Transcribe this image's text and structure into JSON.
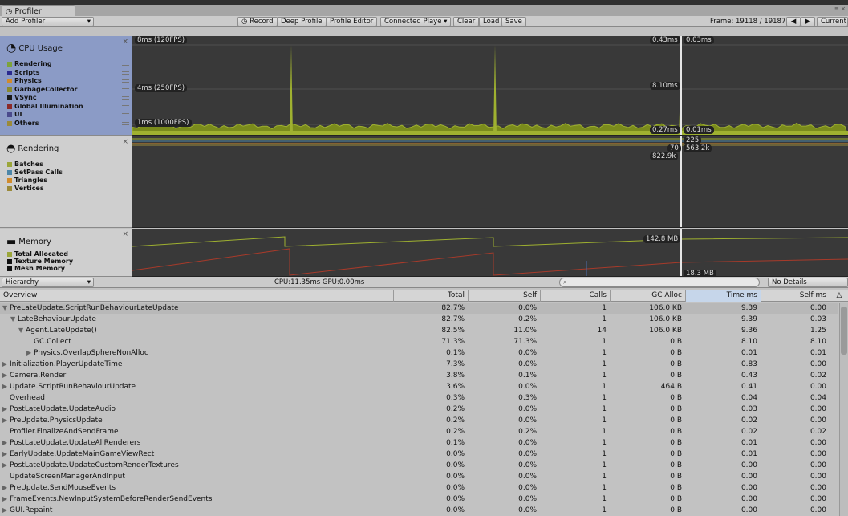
{
  "window": {
    "tab_title": "Profiler",
    "controls": "≡ ×"
  },
  "toolbar": {
    "add_profiler": "Add Profiler",
    "record": "Record",
    "deep_profile": "Deep Profile",
    "profile_editor": "Profile Editor",
    "connected_player": "Connected Playe ▾",
    "clear": "Clear",
    "load": "Load",
    "save": "Save",
    "frame_label": "Frame:",
    "frame_value": "19118 / 19187",
    "prev": "◀",
    "next": "▶",
    "current": "Current"
  },
  "cpu": {
    "title": "CPU Usage",
    "legend": [
      {
        "label": "Rendering",
        "color": "#7da33b"
      },
      {
        "label": "Scripts",
        "color": "#2a2a90"
      },
      {
        "label": "Physics",
        "color": "#d18b2c"
      },
      {
        "label": "GarbageCollector",
        "color": "#8a8a30"
      },
      {
        "label": "VSync",
        "color": "#1a1a1a"
      },
      {
        "label": "Global Illumination",
        "color": "#8c2a2a"
      },
      {
        "label": "UI",
        "color": "#4a4a8c"
      },
      {
        "label": "Others",
        "color": "#9b8a3a"
      }
    ],
    "gridlines": [
      "8ms (120FPS)",
      "4ms (250FPS)",
      "1ms (1000FPS)"
    ],
    "readouts": {
      "top_a": "0.43ms",
      "top_b": "0.03ms",
      "mid": "8.10ms",
      "low_a": "0.27ms",
      "low_b": "0.01ms"
    }
  },
  "rendering": {
    "title": "Rendering",
    "legend": [
      {
        "label": "Batches",
        "color": "#9ba63a"
      },
      {
        "label": "SetPass Calls",
        "color": "#4d86a8"
      },
      {
        "label": "Triangles",
        "color": "#d18b2c"
      },
      {
        "label": "Vertices",
        "color": "#9b8a3a"
      }
    ],
    "readouts": {
      "a": "225",
      "b": "70",
      "c": "563.2k",
      "d": "822.9k"
    }
  },
  "memory": {
    "title": "Memory",
    "legend": [
      {
        "label": "Total Allocated",
        "color": "#9ba63a"
      },
      {
        "label": "Texture Memory",
        "color": "#111111"
      },
      {
        "label": "Mesh Memory",
        "color": "#111111"
      }
    ],
    "readouts": {
      "a": "142.8 MB",
      "b": "18.3 MB"
    }
  },
  "hierarchy": {
    "mode": "Hierarchy",
    "timing": "CPU:11.35ms  GPU:0.00ms",
    "search_placeholder": "",
    "details": "No Details"
  },
  "table": {
    "columns": [
      "Overview",
      "Total",
      "Self",
      "Calls",
      "GC Alloc",
      "Time ms",
      "Self ms"
    ],
    "rows": [
      {
        "indent": 0,
        "arrow": "▼",
        "name": "PreLateUpdate.ScriptRunBehaviourLateUpdate",
        "total": "82.7%",
        "self": "0.0%",
        "calls": "1",
        "gc": "106.0 KB",
        "time": "9.39",
        "selfms": "0.00"
      },
      {
        "indent": 1,
        "arrow": "▼",
        "name": "LateBehaviourUpdate",
        "total": "82.7%",
        "self": "0.2%",
        "calls": "1",
        "gc": "106.0 KB",
        "time": "9.39",
        "selfms": "0.03"
      },
      {
        "indent": 2,
        "arrow": "▼",
        "name": "Agent.LateUpdate()",
        "total": "82.5%",
        "self": "11.0%",
        "calls": "14",
        "gc": "106.0 KB",
        "time": "9.36",
        "selfms": "1.25"
      },
      {
        "indent": 3,
        "arrow": "",
        "name": "GC.Collect",
        "total": "71.3%",
        "self": "71.3%",
        "calls": "1",
        "gc": "0 B",
        "time": "8.10",
        "selfms": "8.10"
      },
      {
        "indent": 3,
        "arrow": "▶",
        "name": "Physics.OverlapSphereNonAlloc",
        "total": "0.1%",
        "self": "0.0%",
        "calls": "1",
        "gc": "0 B",
        "time": "0.01",
        "selfms": "0.01"
      },
      {
        "indent": 0,
        "arrow": "▶",
        "name": "Initialization.PlayerUpdateTime",
        "total": "7.3%",
        "self": "0.0%",
        "calls": "1",
        "gc": "0 B",
        "time": "0.83",
        "selfms": "0.00"
      },
      {
        "indent": 0,
        "arrow": "▶",
        "name": "Camera.Render",
        "total": "3.8%",
        "self": "0.1%",
        "calls": "1",
        "gc": "0 B",
        "time": "0.43",
        "selfms": "0.02"
      },
      {
        "indent": 0,
        "arrow": "▶",
        "name": "Update.ScriptRunBehaviourUpdate",
        "total": "3.6%",
        "self": "0.0%",
        "calls": "1",
        "gc": "464 B",
        "time": "0.41",
        "selfms": "0.00"
      },
      {
        "indent": 0,
        "arrow": "",
        "name": "Overhead",
        "total": "0.3%",
        "self": "0.3%",
        "calls": "1",
        "gc": "0 B",
        "time": "0.04",
        "selfms": "0.04"
      },
      {
        "indent": 0,
        "arrow": "▶",
        "name": "PostLateUpdate.UpdateAudio",
        "total": "0.2%",
        "self": "0.0%",
        "calls": "1",
        "gc": "0 B",
        "time": "0.03",
        "selfms": "0.00"
      },
      {
        "indent": 0,
        "arrow": "▶",
        "name": "PreUpdate.PhysicsUpdate",
        "total": "0.2%",
        "self": "0.0%",
        "calls": "1",
        "gc": "0 B",
        "time": "0.02",
        "selfms": "0.00"
      },
      {
        "indent": 0,
        "arrow": "",
        "name": "Profiler.FinalizeAndSendFrame",
        "total": "0.2%",
        "self": "0.2%",
        "calls": "1",
        "gc": "0 B",
        "time": "0.02",
        "selfms": "0.02"
      },
      {
        "indent": 0,
        "arrow": "▶",
        "name": "PostLateUpdate.UpdateAllRenderers",
        "total": "0.1%",
        "self": "0.0%",
        "calls": "1",
        "gc": "0 B",
        "time": "0.01",
        "selfms": "0.00"
      },
      {
        "indent": 0,
        "arrow": "▶",
        "name": "EarlyUpdate.UpdateMainGameViewRect",
        "total": "0.0%",
        "self": "0.0%",
        "calls": "1",
        "gc": "0 B",
        "time": "0.01",
        "selfms": "0.00"
      },
      {
        "indent": 0,
        "arrow": "▶",
        "name": "PostLateUpdate.UpdateCustomRenderTextures",
        "total": "0.0%",
        "self": "0.0%",
        "calls": "1",
        "gc": "0 B",
        "time": "0.00",
        "selfms": "0.00"
      },
      {
        "indent": 0,
        "arrow": "",
        "name": "UpdateScreenManagerAndInput",
        "total": "0.0%",
        "self": "0.0%",
        "calls": "1",
        "gc": "0 B",
        "time": "0.00",
        "selfms": "0.00"
      },
      {
        "indent": 0,
        "arrow": "▶",
        "name": "PreUpdate.SendMouseEvents",
        "total": "0.0%",
        "self": "0.0%",
        "calls": "1",
        "gc": "0 B",
        "time": "0.00",
        "selfms": "0.00"
      },
      {
        "indent": 0,
        "arrow": "▶",
        "name": "FrameEvents.NewInputSystemBeforeRenderSendEvents",
        "total": "0.0%",
        "self": "0.0%",
        "calls": "1",
        "gc": "0 B",
        "time": "0.00",
        "selfms": "0.00"
      },
      {
        "indent": 0,
        "arrow": "▶",
        "name": "GUI.Repaint",
        "total": "0.0%",
        "self": "0.0%",
        "calls": "1",
        "gc": "0 B",
        "time": "0.00",
        "selfms": "0.00"
      }
    ]
  }
}
